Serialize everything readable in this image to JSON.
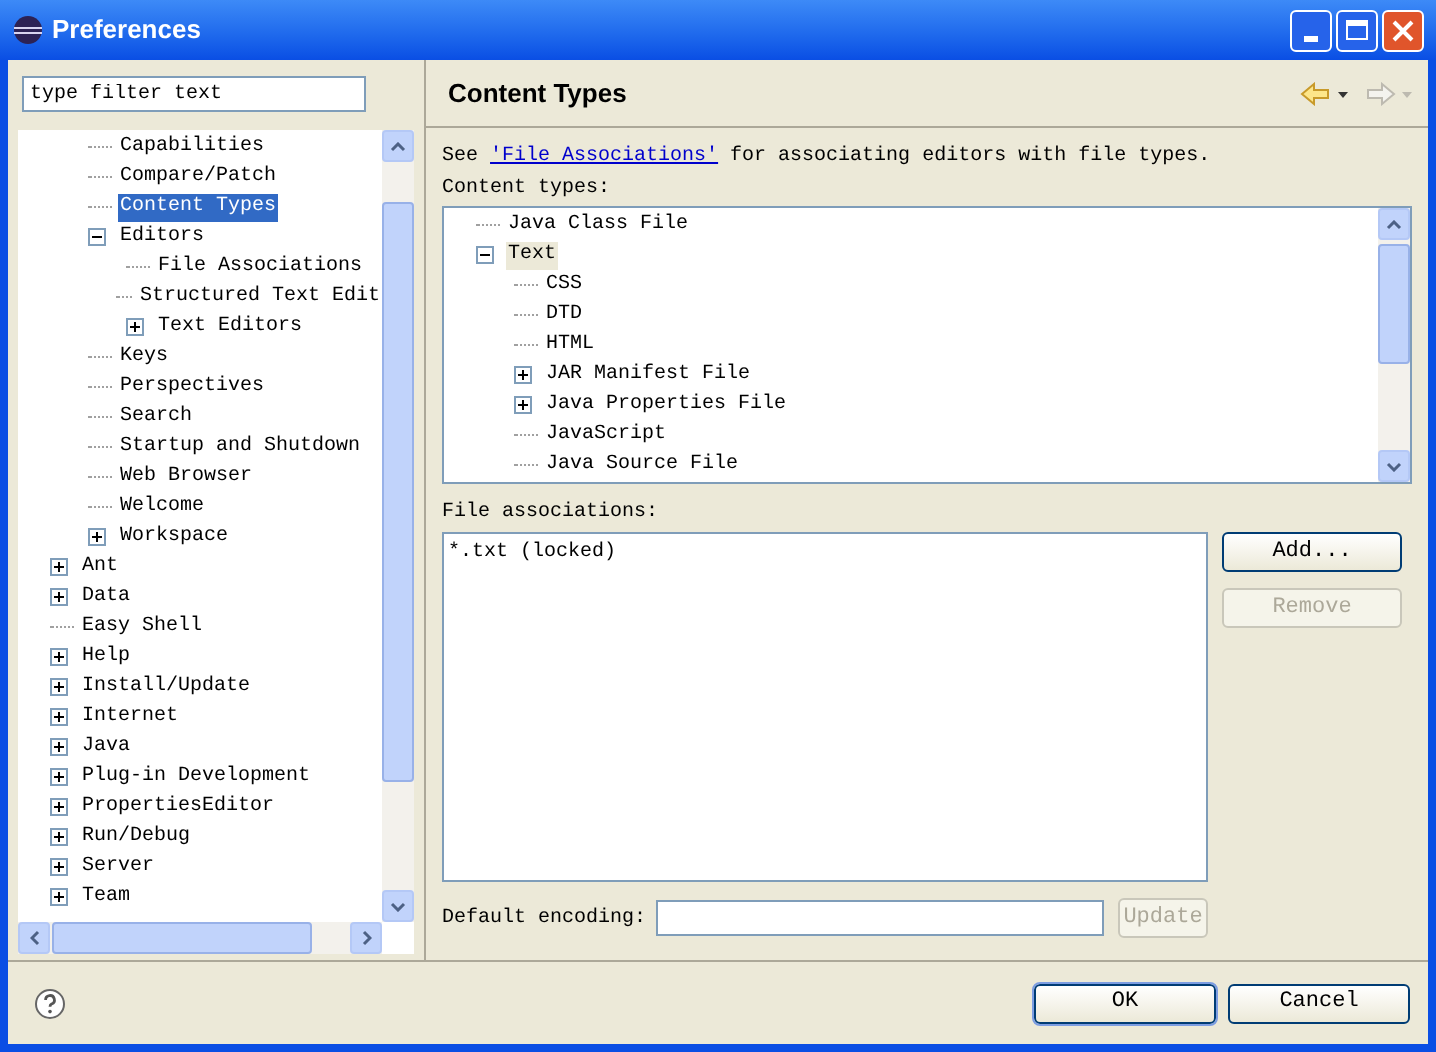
{
  "window": {
    "title": "Preferences"
  },
  "filter": {
    "value": "type filter text"
  },
  "tree": {
    "continued_children": [
      {
        "label": "Capabilities",
        "selected": false
      },
      {
        "label": "Compare/Patch",
        "selected": false
      },
      {
        "label": "Content Types",
        "selected": true
      },
      {
        "label": "Editors",
        "selected": false,
        "expanded": true,
        "children": [
          {
            "label": "File Associations",
            "selected": false
          },
          {
            "label": "Structured Text Edit",
            "selected": false
          },
          {
            "label": "Text Editors",
            "selected": false,
            "expanded": false
          }
        ]
      },
      {
        "label": "Keys",
        "selected": false
      },
      {
        "label": "Perspectives",
        "selected": false
      },
      {
        "label": "Search",
        "selected": false
      },
      {
        "label": "Startup and Shutdown",
        "selected": false
      },
      {
        "label": "Web Browser",
        "selected": false
      },
      {
        "label": "Welcome",
        "selected": false
      },
      {
        "label": "Workspace",
        "selected": false,
        "expanded": false
      }
    ],
    "items": [
      {
        "label": "Ant",
        "selected": false,
        "expanded": false
      },
      {
        "label": "Data",
        "selected": false,
        "expanded": false
      },
      {
        "label": "Easy Shell",
        "selected": false
      },
      {
        "label": "Help",
        "selected": false,
        "expanded": false
      },
      {
        "label": "Install/Update",
        "selected": false,
        "expanded": false
      },
      {
        "label": "Internet",
        "selected": false,
        "expanded": false
      },
      {
        "label": "Java",
        "selected": false,
        "expanded": false
      },
      {
        "label": "Plug-in Development",
        "selected": false,
        "expanded": false
      },
      {
        "label": "PropertiesEditor",
        "selected": false,
        "expanded": false
      },
      {
        "label": "Run/Debug",
        "selected": false,
        "expanded": false
      },
      {
        "label": "Server",
        "selected": false,
        "expanded": false
      },
      {
        "label": "Team",
        "selected": false,
        "expanded": false
      }
    ]
  },
  "page": {
    "title": "Content Types",
    "description": {
      "before": "See ",
      "link": "'File Associations'",
      "after": " for associating editors with file types."
    },
    "content_types_label": "Content types:",
    "content_types": [
      {
        "label": "Java Class File",
        "selected": false
      },
      {
        "label": "Text",
        "selected": true,
        "expanded": true,
        "children": [
          {
            "label": "CSS",
            "selected": false
          },
          {
            "label": "DTD",
            "selected": false
          },
          {
            "label": "HTML",
            "selected": false
          },
          {
            "label": "JAR Manifest File",
            "selected": false,
            "expanded": false
          },
          {
            "label": "Java Properties File",
            "selected": false,
            "expanded": false
          },
          {
            "label": "JavaScript",
            "selected": false
          },
          {
            "label": "Java Source File",
            "selected": false
          }
        ]
      }
    ],
    "file_associations_label": "File associations:",
    "file_associations": [
      "*.txt (locked)"
    ],
    "buttons": [
      {
        "label": "Add...",
        "disabled": false
      },
      {
        "label": "Remove",
        "disabled": true
      }
    ],
    "encoding": {
      "label": "Default encoding:",
      "button": {
        "label": "Update",
        "disabled": true
      }
    }
  },
  "footer": {
    "buttons": [
      {
        "label": "OK",
        "default": true
      },
      {
        "label": "Cancel",
        "default": false
      }
    ]
  }
}
